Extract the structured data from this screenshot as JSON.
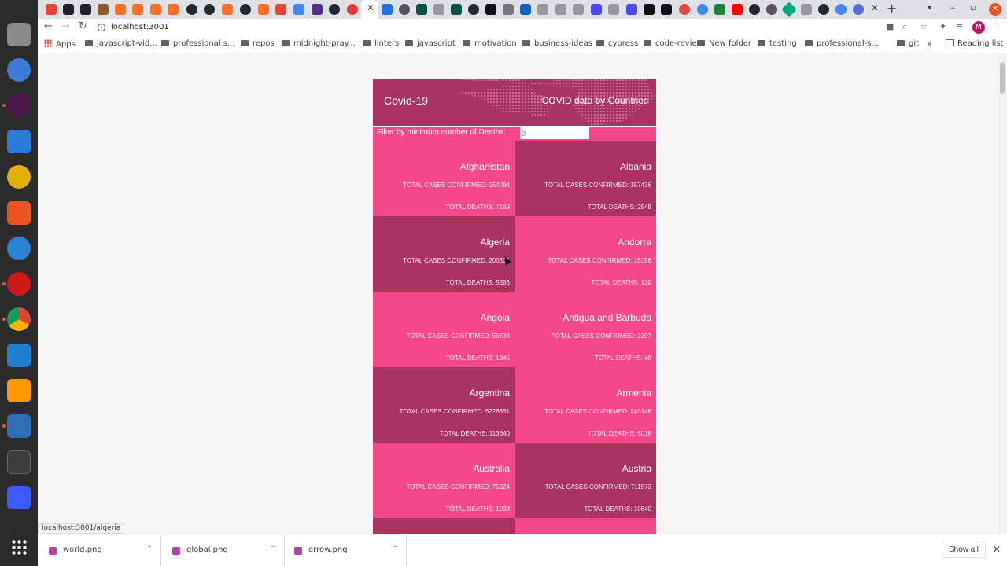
{
  "browser": {
    "url": "localhost:3001",
    "status_url": "localhost:3001/algeria",
    "reading_list": "Reading list",
    "profile_initial": "M"
  },
  "bookmarks": [
    {
      "label": "Apps",
      "type": "apps"
    },
    {
      "label": "javascript-vid...",
      "type": "folder"
    },
    {
      "label": "professional s...",
      "type": "folder"
    },
    {
      "label": "repos",
      "type": "folder"
    },
    {
      "label": "midnight-pray...",
      "type": "folder"
    },
    {
      "label": "linters",
      "type": "folder"
    },
    {
      "label": "javascript",
      "type": "folder"
    },
    {
      "label": "motivation",
      "type": "folder"
    },
    {
      "label": "business-ideas",
      "type": "folder"
    },
    {
      "label": "cypress",
      "type": "folder"
    },
    {
      "label": "code-review",
      "type": "folder"
    },
    {
      "label": "New folder",
      "type": "folder"
    },
    {
      "label": "testing",
      "type": "folder"
    },
    {
      "label": "professional-s...",
      "type": "folder"
    },
    {
      "label": "git",
      "type": "folder"
    }
  ],
  "app": {
    "logo": "Covid-19",
    "title": "COVID data by Countries",
    "filter_label": "Filter by minimum number of Deaths:",
    "filter_value": "0",
    "cases_prefix": "TOTAL CASES CONFIRMED:",
    "deaths_prefix": "TOTAL DEATHS:"
  },
  "countries": [
    {
      "name": "Afghanistan",
      "cases": "TOTAL CASES CONFIRMED: 154094",
      "deaths": "TOTAL DEATHS: 7169",
      "tone": "light"
    },
    {
      "name": "Albania",
      "cases": "TOTAL CASES CONFIRMED: 157436",
      "deaths": "TOTAL DEATHS: 2548",
      "tone": "dark"
    },
    {
      "name": "Algeria",
      "cases": "TOTAL CASES CONFIRMED: 200301",
      "deaths": "TOTAL DEATHS: 5596",
      "tone": "dark"
    },
    {
      "name": "Andorra",
      "cases": "TOTAL CASES CONFIRMED: 15096",
      "deaths": "TOTAL DEATHS: 130",
      "tone": "light"
    },
    {
      "name": "Angola",
      "cases": "TOTAL CASES CONFIRMED: 50738",
      "deaths": "TOTAL DEATHS: 1345",
      "tone": "light"
    },
    {
      "name": "Antigua and Barbuda",
      "cases": "TOTAL CASES CONFIRMED: 2297",
      "deaths": "TOTAL DEATHS: 48",
      "tone": "light"
    },
    {
      "name": "Argentina",
      "cases": "TOTAL CASES CONFIRMED: 5226831",
      "deaths": "TOTAL DEATHS: 113640",
      "tone": "dark"
    },
    {
      "name": "Armenia",
      "cases": "TOTAL CASES CONFIRMED: 249146",
      "deaths": "TOTAL DEATHS: 5018",
      "tone": "light"
    },
    {
      "name": "Australia",
      "cases": "TOTAL CASES CONFIRMED: 75324",
      "deaths": "TOTAL DEATHS: 1098",
      "tone": "light"
    },
    {
      "name": "Austria",
      "cases": "TOTAL CASES CONFIRMED: 711573",
      "deaths": "TOTAL DEATHS: 10840",
      "tone": "dark"
    },
    {
      "name": "",
      "cases": "",
      "deaths": "",
      "tone": "dark"
    },
    {
      "name": "",
      "cases": "",
      "deaths": "",
      "tone": "light"
    }
  ],
  "downloads": [
    {
      "name": "world.png"
    },
    {
      "name": "global.png"
    },
    {
      "name": "arrow.png"
    }
  ],
  "download_shelf": {
    "show_all": "Show all"
  },
  "colors": {
    "card_light": "#f5488b",
    "card_dark": "#a8345f",
    "header": "#a8345f"
  }
}
